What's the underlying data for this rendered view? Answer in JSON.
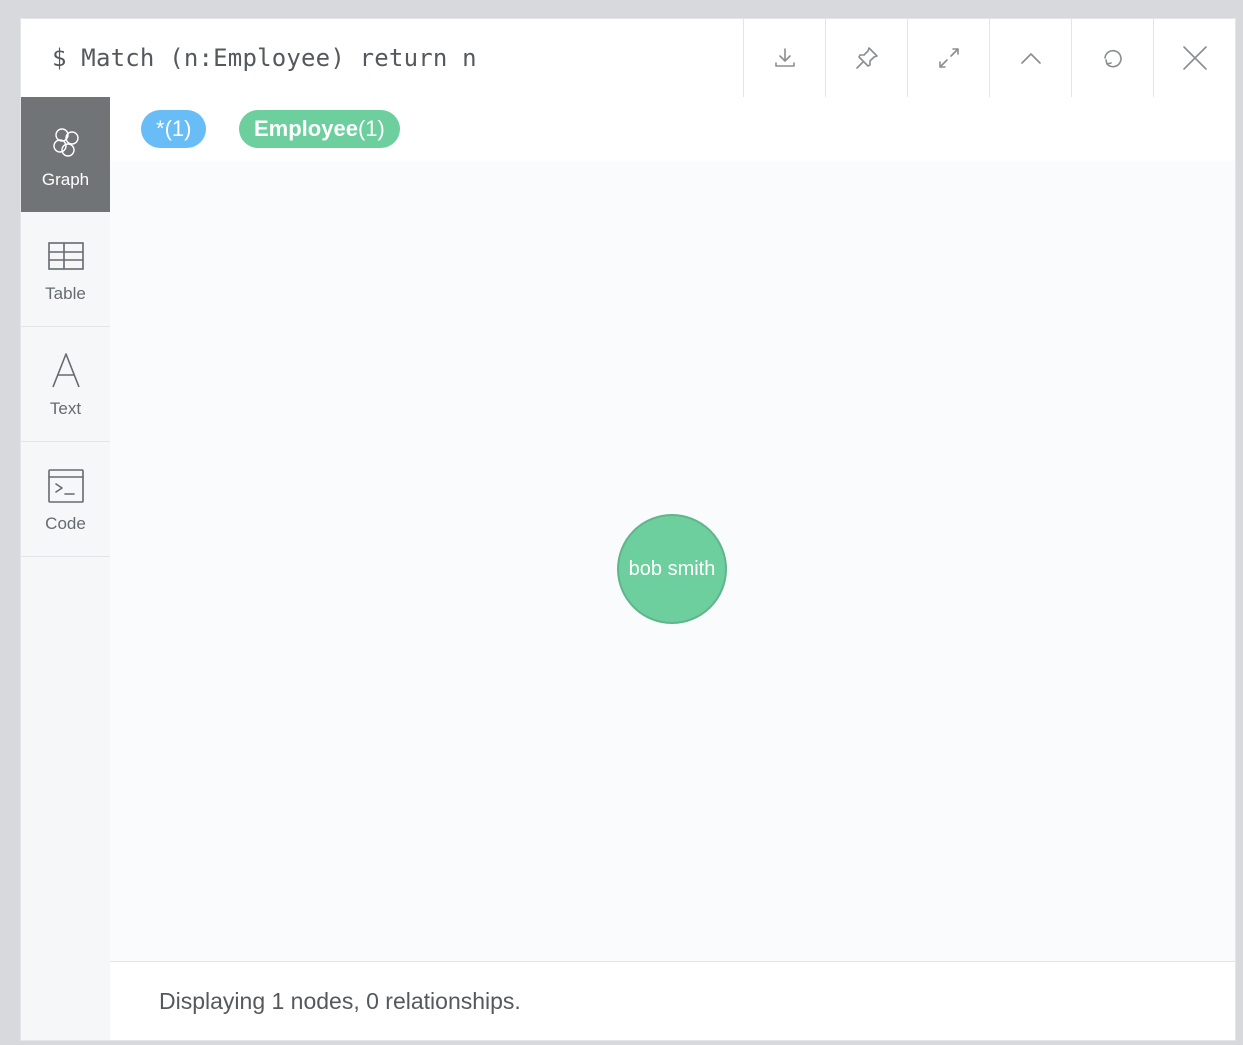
{
  "header": {
    "query": "$ Match (n:Employee) return n",
    "actions": [
      "download-icon",
      "pin-icon",
      "expand-icon",
      "collapse-icon",
      "rerun-icon",
      "close-icon"
    ]
  },
  "sidebar": {
    "items": [
      {
        "label": "Graph",
        "icon": "graph-icon",
        "active": true
      },
      {
        "label": "Table",
        "icon": "table-icon"
      },
      {
        "label": "Text",
        "icon": "text-icon"
      },
      {
        "label": "Code",
        "icon": "code-icon"
      }
    ]
  },
  "legend": {
    "all": {
      "label": "*",
      "count": "(1)"
    },
    "employee": {
      "label": "Employee",
      "count": "(1)"
    }
  },
  "graph": {
    "nodes": [
      {
        "caption": "bob smith",
        "label": "Employee"
      }
    ]
  },
  "status": {
    "text": "Displaying 1 nodes, 0 relationships."
  },
  "colors": {
    "all_label": "#68bdf6",
    "employee": "#6dce9e",
    "active_tab": "#717476"
  }
}
